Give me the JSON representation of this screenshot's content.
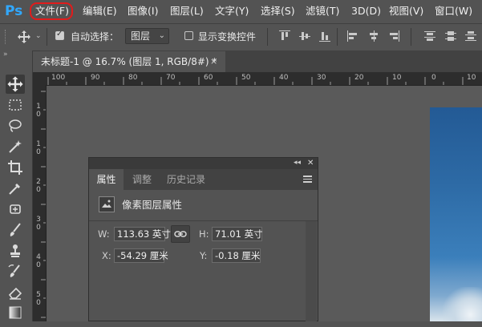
{
  "app": {
    "logo": "Ps"
  },
  "menu": {
    "items": [
      {
        "label": "文件(F)"
      },
      {
        "label": "编辑(E)"
      },
      {
        "label": "图像(I)"
      },
      {
        "label": "图层(L)"
      },
      {
        "label": "文字(Y)"
      },
      {
        "label": "选择(S)"
      },
      {
        "label": "滤镜(T)"
      },
      {
        "label": "3D(D)"
      },
      {
        "label": "视图(V)"
      },
      {
        "label": "窗口(W)"
      }
    ],
    "highlight_color": "#e21b1b"
  },
  "options": {
    "auto_select_label": "自动选择：",
    "auto_select_checked": true,
    "layer_select_value": "图层",
    "show_transform_label": "显示变换控件",
    "show_transform_checked": false
  },
  "document": {
    "tab_title": "未标题-1 @ 16.7% (图层 1, RGB/8#) *",
    "close_glyph": "×"
  },
  "rulers": {
    "horizontal": [
      "100",
      "90",
      "80",
      "70",
      "60",
      "50",
      "40",
      "30",
      "20",
      "10",
      "0",
      "10"
    ],
    "vertical": [
      "1",
      "0",
      "1",
      "0",
      "2",
      "0",
      "3",
      "0",
      "4",
      "0",
      "5",
      "0",
      "6",
      "0"
    ]
  },
  "properties": {
    "tabs": [
      {
        "label": "属性",
        "active": true
      },
      {
        "label": "调整",
        "active": false
      },
      {
        "label": "历史记录",
        "active": false
      }
    ],
    "section_title": "像素图层属性",
    "fields": {
      "w_label": "W:",
      "w_value": "113.63 英寸",
      "h_label": "H:",
      "h_value": "71.01 英寸",
      "x_label": "X:",
      "x_value": "-54.29 厘米",
      "y_label": "Y:",
      "y_value": "-0.18 厘米"
    },
    "collapse_glyph": "◂◂",
    "close_glyph": "✕"
  },
  "colors": {
    "ps_blue": "#31a8ff",
    "ui_bg": "#535353",
    "ruler_bg": "#2d2d2d"
  }
}
